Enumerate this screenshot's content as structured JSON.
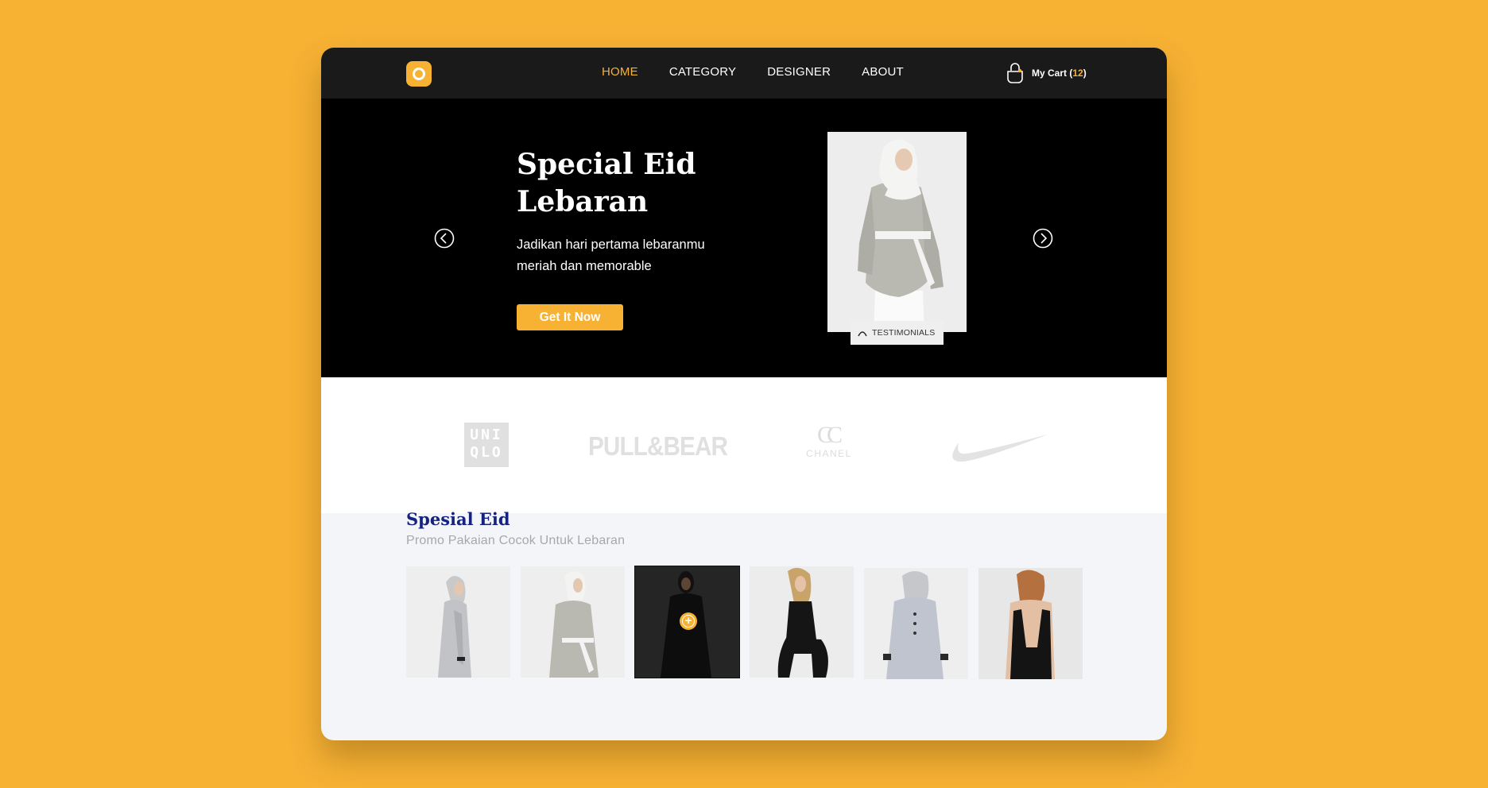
{
  "header": {
    "logo": "logo-icon",
    "nav": [
      {
        "label": "HOME",
        "active": true
      },
      {
        "label": "CATEGORY",
        "active": false
      },
      {
        "label": "DESIGNER",
        "active": false
      },
      {
        "label": "ABOUT",
        "active": false
      }
    ],
    "cart": {
      "label": "My Cart (",
      "count": "12",
      "close": ")",
      "icon": "shopping-bag-icon"
    }
  },
  "hero": {
    "title": "Special Eid Lebaran",
    "subtitle": "Jadikan hari pertama lebaranmu meriah dan memorable",
    "cta_label": "Get It Now",
    "testimonials_label": "TESTIMONIALS",
    "prev_icon": "chevron-left-circle-icon",
    "next_icon": "chevron-right-circle-icon"
  },
  "brands": {
    "uniqlo_top": "UNI",
    "uniqlo_bottom": "QLO",
    "pullbear": "PULL&BEAR",
    "chanel_mark": "CC",
    "chanel_name": "CHANEL",
    "nike": "nike-swoosh-logo"
  },
  "promo": {
    "title": "Spesial Eid",
    "subtitle": "Promo Pakaian Cocok Untuk  Lebaran",
    "products": [
      {
        "name": "grey hijab tunic side view"
      },
      {
        "name": "grey bell-sleeve blazer with hijab"
      },
      {
        "name": "black dress hovered",
        "add_icon": "add-circle-icon"
      },
      {
        "name": "black sleeveless dress"
      },
      {
        "name": "grey tunic back view"
      },
      {
        "name": "black open-back top"
      }
    ]
  },
  "colors": {
    "accent": "#F7B234",
    "header_bg": "#1A1A1A",
    "hero_bg": "#000000",
    "title_navy": "#152280",
    "section_bg": "#F4F5F9"
  }
}
